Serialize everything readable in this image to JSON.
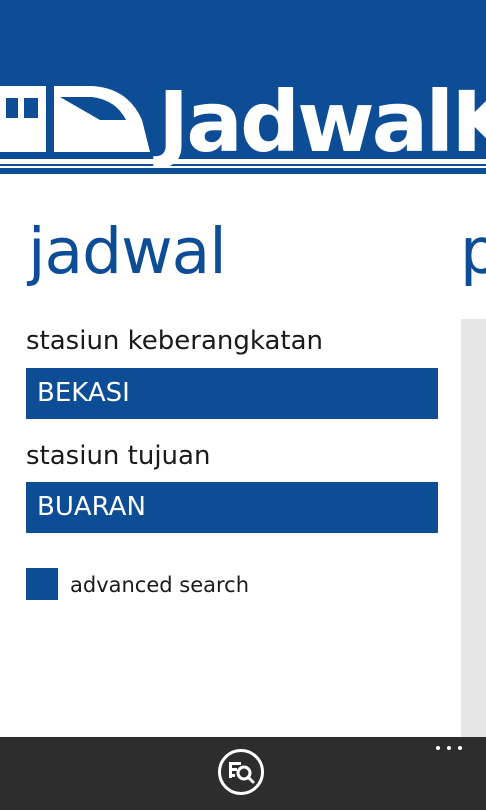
{
  "app": {
    "brand": "JadwalKRL",
    "accent": "#0d4d96"
  },
  "pivot": {
    "title": "jadwal",
    "next_title_peek": "p"
  },
  "form": {
    "departure_label": "stasiun keberangkatan",
    "departure_value": "BEKASI",
    "destination_label": "stasiun tujuan",
    "destination_value": "BUARAN",
    "advanced_label": "advanced search",
    "advanced_checked": false
  },
  "appbar": {
    "search_icon": "search-schedule-icon",
    "more_icon": "ellipsis-icon"
  }
}
